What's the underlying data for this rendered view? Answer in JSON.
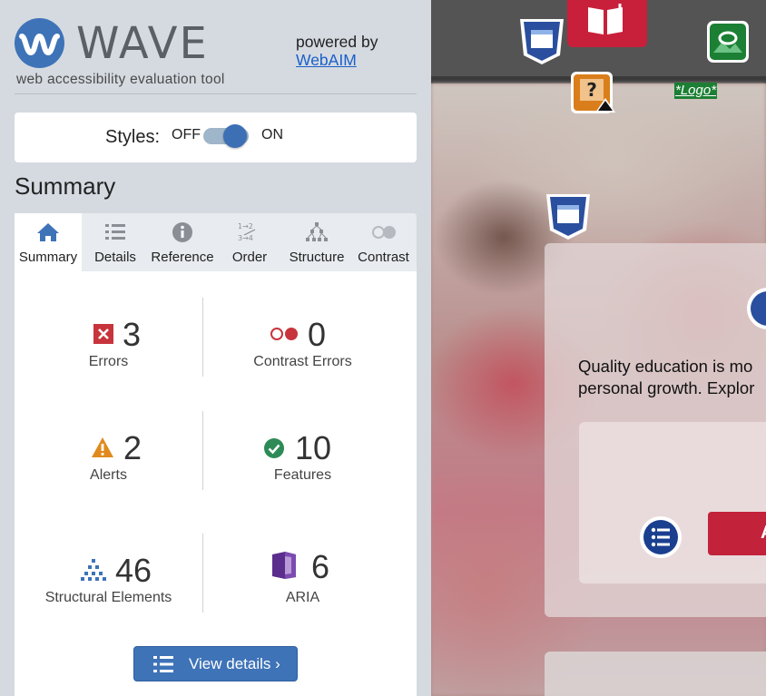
{
  "brand": {
    "name": "WAVE",
    "tagline": "web accessibility evaluation tool",
    "powered_by": "powered by",
    "webaim_link": "WebAIM"
  },
  "styles_toggle": {
    "label": "Styles:",
    "off": "OFF",
    "on": "ON",
    "state": "on"
  },
  "summary_heading": "Summary",
  "tabs": [
    {
      "label": "Summary",
      "icon": "home-icon",
      "active": true
    },
    {
      "label": "Details",
      "icon": "list-icon",
      "active": false
    },
    {
      "label": "Reference",
      "icon": "info-icon",
      "active": false
    },
    {
      "label": "Order",
      "icon": "order-icon",
      "active": false
    },
    {
      "label": "Structure",
      "icon": "structure-icon",
      "active": false
    },
    {
      "label": "Contrast",
      "icon": "contrast-icon",
      "active": false
    }
  ],
  "stats": {
    "errors": {
      "count": "3",
      "label": "Errors",
      "color": "#c7343c"
    },
    "contrast_errors": {
      "count": "0",
      "label": "Contrast Errors",
      "color": "#c7343c"
    },
    "alerts": {
      "count": "2",
      "label": "Alerts",
      "color": "#e08a1e"
    },
    "features": {
      "count": "10",
      "label": "Features",
      "color": "#2e8b57"
    },
    "structural": {
      "count": "46",
      "label": "Structural Elements",
      "color": "#3e73b8"
    },
    "aria": {
      "count": "6",
      "label": "ARIA",
      "color": "#5b2d8c"
    }
  },
  "view_details_button": "View details ›",
  "preview": {
    "logo_alt": "*Logo*",
    "body_text_line1": "Quality education is mo",
    "body_text_line2": "personal growth. Explor",
    "button_text": "A"
  }
}
